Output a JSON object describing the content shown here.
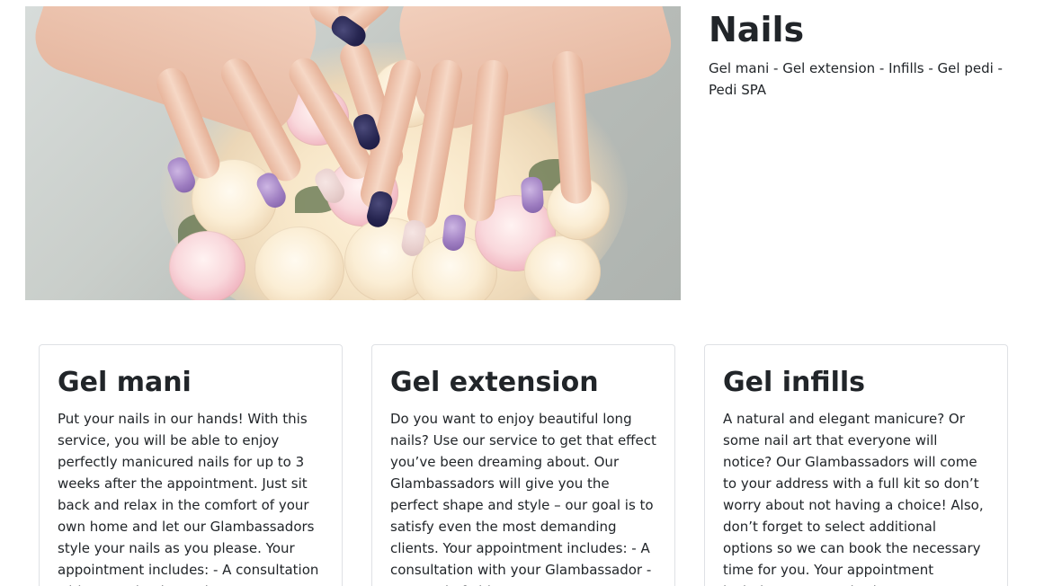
{
  "hero": {
    "image_alt": "Hands with manicured nails over a bouquet of roses"
  },
  "page": {
    "title": "Nails",
    "subtitle": "Gel mani - Gel extension - Infills - Gel pedi - Pedi SPA"
  },
  "cards": [
    {
      "title": "Gel mani",
      "text": "Put your nails in our hands! With this service, you will be able to enjoy perfectly manicured nails for up to 3 weeks after the appointment. Just sit back and relax in the comfort of your own home and let our Glambassadors style your nails as you please. Your appointment includes: - A consultation with your Glambassador -"
    },
    {
      "title": "Gel extension",
      "text": "Do you want to enjoy beautiful long nails? Use our service to get that effect you’ve been dreaming about. Our Glambassadors will give you the perfect shape and style – our goal is to satisfy even the most demanding clients. Your appointment includes: - A consultation with your Glambassador - Removal of old"
    },
    {
      "title": "Gel infills",
      "text": "A natural and elegant manicure? Or some nail art that everyone will notice? Our Glambassadors will come to your address with a full kit so don’t worry about not having a choice! Also, don’t forget to select additional options so we can book the necessary time for you. Your appointment includes: - A consultation"
    }
  ],
  "colors": {
    "text": "#212529",
    "card_border": "#dfe1e5",
    "background": "#ffffff"
  }
}
